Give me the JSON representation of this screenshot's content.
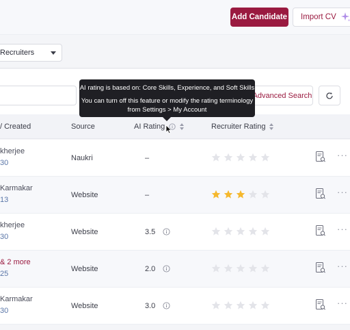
{
  "header": {
    "add_candidate": "Add Candidate",
    "import_cv": "Import CV"
  },
  "filters": {
    "select_value": "Recruiters"
  },
  "toolbar": {
    "advanced_search": "Advanced Search"
  },
  "table": {
    "columns": {
      "created": "/ Created",
      "source": "Source",
      "ai_rating": "AI Rating",
      "recruiter_rating": "Recruiter Rating"
    },
    "rows": [
      {
        "name": "kherjee",
        "date": "30",
        "source": "Naukri",
        "ai": "–",
        "stars": 0
      },
      {
        "name": "Karmakar",
        "date": "13",
        "source": "Website",
        "ai": "–",
        "stars": 3
      },
      {
        "name": "kherjee",
        "date": "30",
        "source": "Website",
        "ai": "3.5",
        "stars": 0
      },
      {
        "name": "& 2 more",
        "date": "25",
        "source": "Website",
        "ai": "2.0",
        "stars": 0
      },
      {
        "name": "Karmakar",
        "date": "30",
        "source": "Website",
        "ai": "3.0",
        "stars": 0
      }
    ]
  },
  "tooltip": {
    "line1": "AI rating is based on: Core Skills, Experience, and Soft Skills",
    "line2": "You can turn off this feature or modify the rating terminology",
    "line3": "from Settings > My Account"
  },
  "colors": {
    "brand": "#9a1a40",
    "star_filled": "#f5b82e",
    "star_empty": "#e3e4e9"
  }
}
